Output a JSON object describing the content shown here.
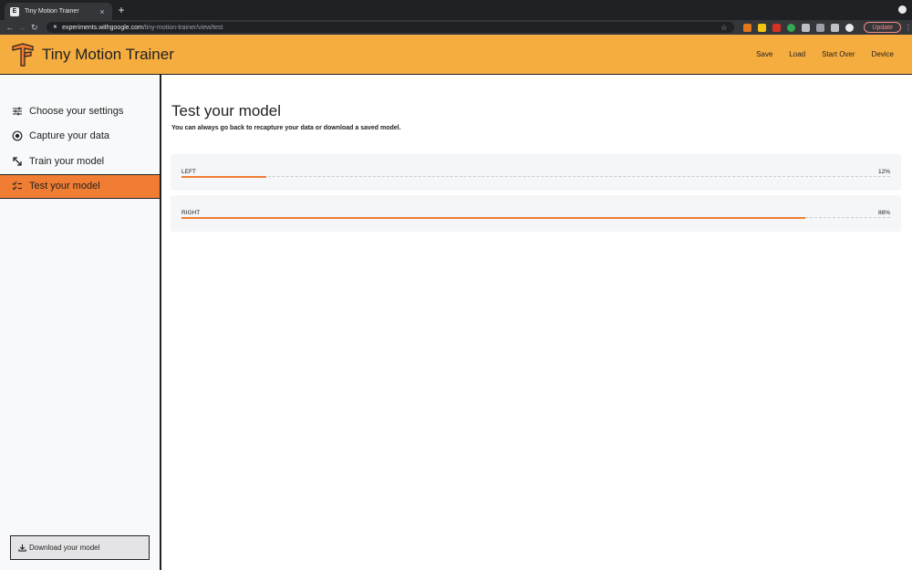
{
  "browser": {
    "tab_title": "Tiny Motion Trainer",
    "tab_favicon": "E",
    "url_host": "experiments.withgoogle.com",
    "url_path": "/tiny-motion-trainer/view/test",
    "update_label": "Update"
  },
  "header": {
    "title": "Tiny Motion Trainer",
    "nav": [
      "Save",
      "Load",
      "Start Over",
      "Device"
    ]
  },
  "sidebar": {
    "steps": [
      {
        "label": "Choose your settings",
        "icon": "sliders-icon"
      },
      {
        "label": "Capture your data",
        "icon": "record-icon"
      },
      {
        "label": "Train your model",
        "icon": "arrows-icon"
      },
      {
        "label": "Test your model",
        "icon": "checklist-icon",
        "active": true
      }
    ],
    "download_label": "Download your model"
  },
  "main": {
    "title": "Test your model",
    "subtitle": "You can always go back to recapture your data or download a saved model.",
    "results": [
      {
        "label": "LEFT",
        "percent": 12,
        "percent_label": "12%"
      },
      {
        "label": "RIGHT",
        "percent": 88,
        "percent_label": "88%"
      }
    ]
  },
  "colors": {
    "header_bg": "#f5ad3f",
    "accent": "#f07d33",
    "sidebar_bg": "#f8f9fa"
  }
}
